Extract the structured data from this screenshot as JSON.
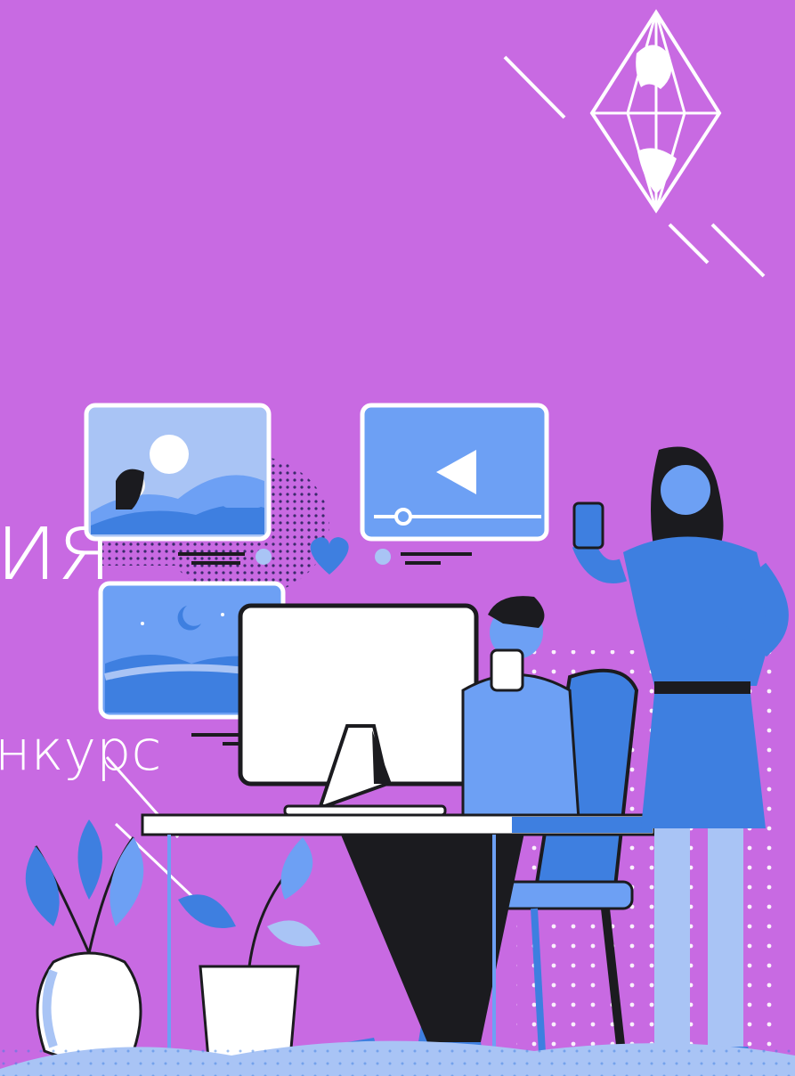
{
  "poster": {
    "title_fragment": "ия",
    "subtitle_fragment": "нкурс"
  },
  "colors": {
    "background": "#c86ae2",
    "blue_primary": "#3e7fe0",
    "blue_light": "#a9c4f5",
    "blue_mid": "#6da0f4",
    "dark": "#1b1b1f",
    "white": "#ffffff"
  },
  "illustration": {
    "logo": "diamond-globe-logo",
    "icons": [
      "photo-card-icon",
      "video-player-icon",
      "night-landscape-card-icon",
      "heart-icon"
    ]
  }
}
